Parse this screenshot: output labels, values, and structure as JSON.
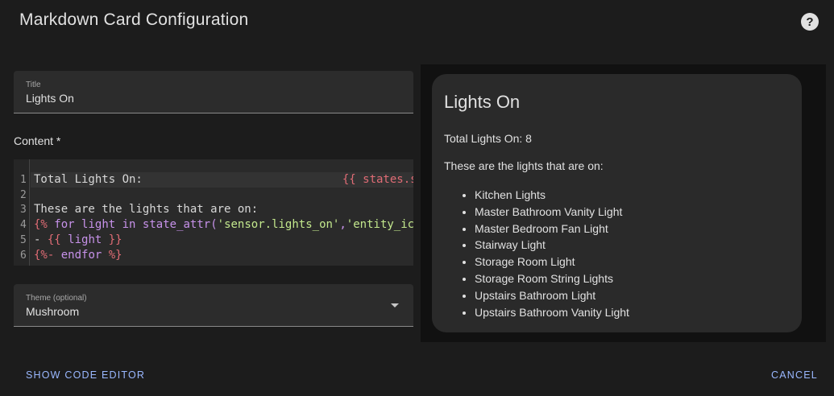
{
  "dialog": {
    "title": "Markdown Card Configuration",
    "help_icon": "question-circle-icon",
    "help_glyph": "?"
  },
  "form": {
    "title_field": {
      "label": "Title",
      "value": "Lights On"
    },
    "content_label": "Content *",
    "code_lines": [
      "1",
      "2",
      "3",
      "4",
      "5",
      "6"
    ],
    "code": {
      "line1_text": "Total Lights On:",
      "line1_expr": "{{ states.s",
      "line3": "These are the lights that are on:",
      "line4_open": "{%",
      "line4_kw_for": "for",
      "line4_light": "light",
      "line4_kw_in": "in",
      "line4_func": "state_attr(",
      "line4_str1": "'sensor.lights_on'",
      "line4_comma": ",",
      "line4_str2": "'entity_ic",
      "line5_dash": "- ",
      "line5_open": "{{",
      "line5_var": "light",
      "line5_close": "}}",
      "line6_open": "{%-",
      "line6_kw": "endfor",
      "line6_close": "%}"
    },
    "theme_field": {
      "label": "Theme (optional)",
      "value": "Mushroom",
      "icon": "chevron-down-icon"
    }
  },
  "preview": {
    "title": "Lights On",
    "total_text": "Total Lights On: 8",
    "intro_text": "These are the lights that are on:",
    "lights": [
      "Kitchen Lights",
      "Master Bathroom Vanity Light",
      "Master Bedroom Fan Light",
      "Stairway Light",
      "Storage Room Light",
      "Storage Room String Lights",
      "Upstairs Bathroom Light",
      "Upstairs Bathroom Vanity Light"
    ]
  },
  "footer": {
    "show_code_label": "SHOW CODE EDITOR",
    "cancel_label": "CANCEL"
  },
  "colors": {
    "background": "#1c1c1c",
    "accent": "#9ab8ff",
    "card": "#2a2a2a"
  }
}
